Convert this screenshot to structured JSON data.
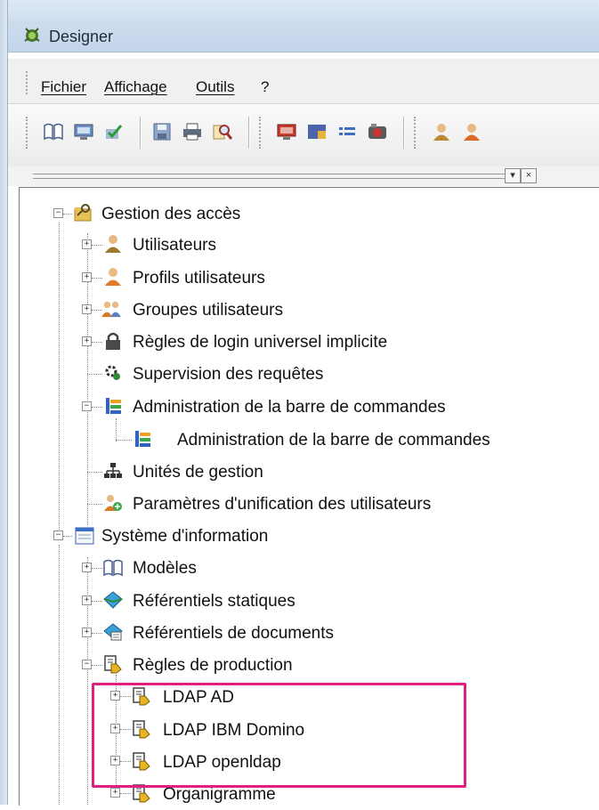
{
  "window": {
    "title": "Designer"
  },
  "menu": [
    {
      "label": "Fichier"
    },
    {
      "label": "Affichage"
    },
    {
      "label": "Outils"
    },
    {
      "label": "?"
    }
  ],
  "toolbar": {
    "buttons": [
      "book-icon",
      "monitor-icon",
      "check-icon",
      "save-icon",
      "print-icon",
      "search-icon",
      "screen-icon",
      "window-icon",
      "list-icon",
      "media-icon",
      "user-icon",
      "user-icon-2"
    ]
  },
  "panel": {
    "dropdown_label": "▾",
    "close_label": "×"
  },
  "tree": [
    {
      "label": "Gestion des accès",
      "icon": "key-folder-icon"
    },
    {
      "label": "Utilisateurs",
      "icon": "user-icon"
    },
    {
      "label": "Profils utilisateurs",
      "icon": "profile-icon"
    },
    {
      "label": "Groupes utilisateurs",
      "icon": "group-icon"
    },
    {
      "label": "Règles de login universel implicite",
      "icon": "lock-icon"
    },
    {
      "label": "Supervision des requêtes",
      "icon": "gear-icon"
    },
    {
      "label": "Administration de la barre de commandes",
      "icon": "commandbar-icon"
    },
    {
      "label": "Administration de la barre de commandes",
      "icon": "commandbar-icon"
    },
    {
      "label": "Unités de gestion",
      "icon": "org-icon"
    },
    {
      "label": "Paramètres d'unification des utilisateurs",
      "icon": "users-settings-icon"
    },
    {
      "label": "Système d'information",
      "icon": "window-icon"
    },
    {
      "label": "Modèles",
      "icon": "book-icon"
    },
    {
      "label": "Référentiels statiques",
      "icon": "diamond-icon"
    },
    {
      "label": "Référentiels de documents",
      "icon": "doc-repo-icon"
    },
    {
      "label": "Règles de production",
      "icon": "rule-icon"
    },
    {
      "label": "LDAP AD",
      "icon": "rule-icon"
    },
    {
      "label": "LDAP IBM Domino",
      "icon": "rule-icon"
    },
    {
      "label": "LDAP openldap",
      "icon": "rule-icon"
    },
    {
      "label": "Organigramme",
      "icon": "rule-icon"
    }
  ],
  "expander": {
    "plus": "+",
    "minus": "−"
  },
  "colors": {
    "highlight": "#e0207f",
    "titlebar": "#cddced"
  }
}
